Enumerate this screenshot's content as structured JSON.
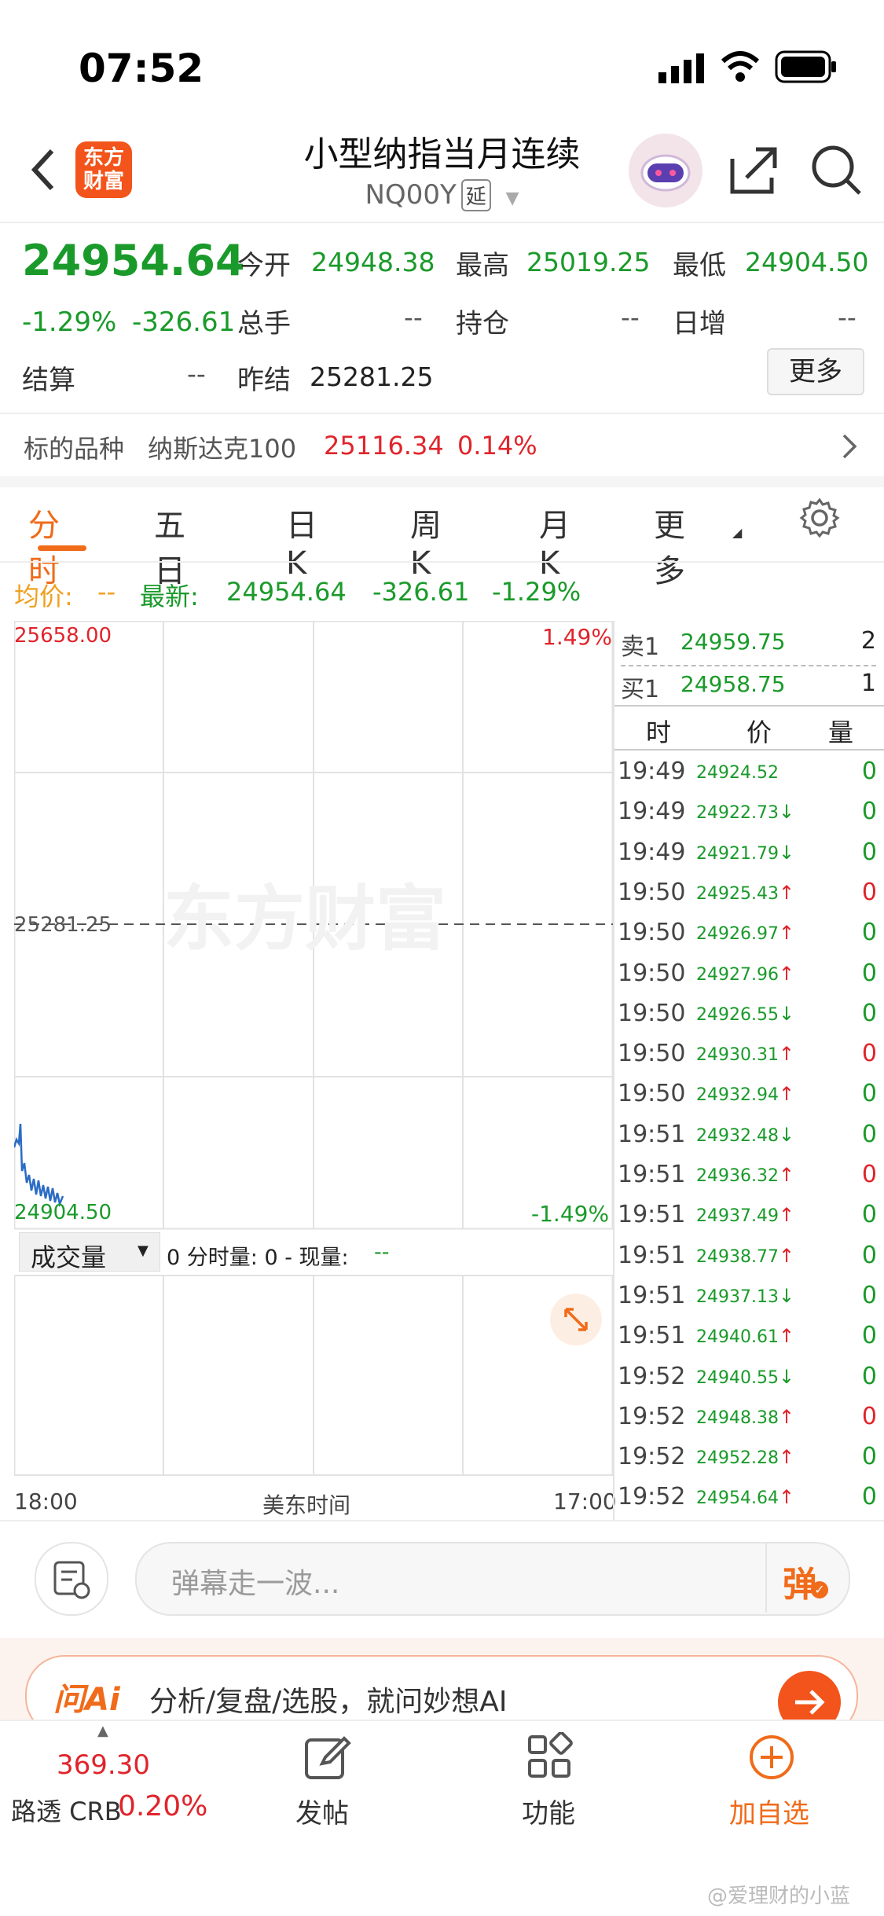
{
  "status_bar": {
    "time": "07:52"
  },
  "nav": {
    "logo_text": "东方财富",
    "title": "小型纳指当月连续",
    "code": "NQ00Y",
    "delay_badge": "延"
  },
  "quote": {
    "last": "24954.64",
    "change_pct": "-1.29%",
    "change": "-326.61",
    "open_label": "今开",
    "open": "24948.38",
    "high_label": "最高",
    "high": "25019.25",
    "low_label": "最低",
    "low": "24904.50",
    "volume_label": "总手",
    "volume": "--",
    "oi_label": "持仓",
    "oi": "--",
    "daily_inc_label": "日增",
    "daily_inc": "--",
    "settle_label": "结算",
    "settle": "--",
    "prev_settle_label": "昨结",
    "prev_settle": "25281.25",
    "more_button": "更多"
  },
  "underlying": {
    "label": "标的品种",
    "name": "纳斯达克100",
    "value": "25116.34",
    "pct": "0.14%"
  },
  "tabs": [
    "分时",
    "五日",
    "日K",
    "周K",
    "月K",
    "更多"
  ],
  "active_tab": "分时",
  "info_line": {
    "avg_label": "均价:",
    "avg_value": "--",
    "latest_label": "最新:",
    "latest_value": "24954.64",
    "latest_change": "-326.61",
    "latest_pct": "-1.29%"
  },
  "chart": {
    "top_value": "25658.00",
    "top_pct": "1.49%",
    "mid_value": "25281.25",
    "bottom_value": "24904.50",
    "bottom_pct": "-1.49%",
    "watermark": "东方财富",
    "volume_selector": "成交量",
    "volume_info": "0 分时量: 0 - 现量:",
    "volume_info_value": "--",
    "x_start": "18:00",
    "x_mid": "美东时间",
    "x_end": "17:00",
    "line_color": "#2b6cc4"
  },
  "order_book": {
    "sell_label": "卖1",
    "sell_price": "24959.75",
    "sell_qty": "2",
    "buy_label": "买1",
    "buy_price": "24958.75",
    "buy_qty": "1"
  },
  "trades_header": {
    "time": "时",
    "price": "价",
    "qty": "量"
  },
  "trades": [
    {
      "time": "19:49",
      "price": "24924.52",
      "dir": "",
      "qty": "0",
      "qty_color": "green"
    },
    {
      "time": "19:49",
      "price": "24922.73",
      "dir": "↓",
      "qty": "0",
      "qty_color": "green"
    },
    {
      "time": "19:49",
      "price": "24921.79",
      "dir": "↓",
      "qty": "0",
      "qty_color": "green"
    },
    {
      "time": "19:50",
      "price": "24925.43",
      "dir": "↑",
      "qty": "0",
      "qty_color": "red"
    },
    {
      "time": "19:50",
      "price": "24926.97",
      "dir": "↑",
      "qty": "0",
      "qty_color": "green"
    },
    {
      "time": "19:50",
      "price": "24927.96",
      "dir": "↑",
      "qty": "0",
      "qty_color": "green"
    },
    {
      "time": "19:50",
      "price": "24926.55",
      "dir": "↓",
      "qty": "0",
      "qty_color": "green"
    },
    {
      "time": "19:50",
      "price": "24930.31",
      "dir": "↑",
      "qty": "0",
      "qty_color": "red"
    },
    {
      "time": "19:50",
      "price": "24932.94",
      "dir": "↑",
      "qty": "0",
      "qty_color": "green"
    },
    {
      "time": "19:51",
      "price": "24932.48",
      "dir": "↓",
      "qty": "0",
      "qty_color": "green"
    },
    {
      "time": "19:51",
      "price": "24936.32",
      "dir": "↑",
      "qty": "0",
      "qty_color": "red"
    },
    {
      "time": "19:51",
      "price": "24937.49",
      "dir": "↑",
      "qty": "0",
      "qty_color": "green"
    },
    {
      "time": "19:51",
      "price": "24938.77",
      "dir": "↑",
      "qty": "0",
      "qty_color": "green"
    },
    {
      "time": "19:51",
      "price": "24937.13",
      "dir": "↓",
      "qty": "0",
      "qty_color": "green"
    },
    {
      "time": "19:51",
      "price": "24940.61",
      "dir": "↑",
      "qty": "0",
      "qty_color": "green"
    },
    {
      "time": "19:52",
      "price": "24940.55",
      "dir": "↓",
      "qty": "0",
      "qty_color": "green"
    },
    {
      "time": "19:52",
      "price": "24948.38",
      "dir": "↑",
      "qty": "0",
      "qty_color": "red"
    },
    {
      "time": "19:52",
      "price": "24952.28",
      "dir": "↑",
      "qty": "0",
      "qty_color": "green"
    },
    {
      "time": "19:52",
      "price": "24954.64",
      "dir": "↑",
      "qty": "0",
      "qty_color": "green"
    }
  ],
  "danmaku": {
    "placeholder": "弹幕走一波...",
    "button": "弹"
  },
  "ai_banner": {
    "logo": "问Ai",
    "text": "分析/复盘/选股，就问妙想AI"
  },
  "bottom_nav": {
    "index_value": "369.30",
    "index_name": "路透 CRB",
    "index_pct": "0.20%",
    "post": "发帖",
    "functions": "功能",
    "add_watch": "加自选"
  },
  "watermark_user": "@爱理财的小蓝"
}
